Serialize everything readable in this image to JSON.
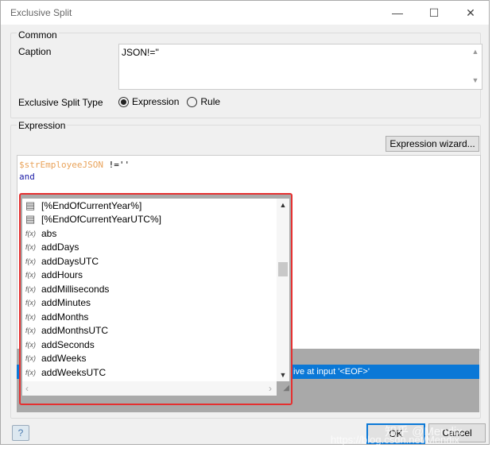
{
  "window": {
    "title": "Exclusive Split",
    "minimize": "—",
    "maximize": "☐",
    "close": "✕"
  },
  "common": {
    "group_label": "Common",
    "caption_label": "Caption",
    "caption_value": "JSON!=''",
    "split_type_label": "Exclusive Split Type",
    "options": [
      {
        "label": "Expression",
        "selected": true
      },
      {
        "label": "Rule",
        "selected": false
      }
    ]
  },
  "expression": {
    "group_label": "Expression",
    "wizard_button": "Expression wizard...",
    "code_line1_var": "$strEmployeeJSON",
    "code_line1_op": " !=''",
    "code_line2": "and"
  },
  "autocomplete": {
    "items": [
      {
        "icon": "constant-icon",
        "label": "[%EndOfCurrentYear%]"
      },
      {
        "icon": "constant-icon",
        "label": "[%EndOfCurrentYearUTC%]"
      },
      {
        "icon": "function-icon",
        "label": "abs"
      },
      {
        "icon": "function-icon",
        "label": "addDays"
      },
      {
        "icon": "function-icon",
        "label": "addDaysUTC"
      },
      {
        "icon": "function-icon",
        "label": "addHours"
      },
      {
        "icon": "function-icon",
        "label": "addMilliseconds"
      },
      {
        "icon": "function-icon",
        "label": "addMinutes"
      },
      {
        "icon": "function-icon",
        "label": "addMonths"
      },
      {
        "icon": "function-icon",
        "label": "addMonthsUTC"
      },
      {
        "icon": "function-icon",
        "label": "addSeconds"
      },
      {
        "icon": "function-icon",
        "label": "addWeeks"
      },
      {
        "icon": "function-icon",
        "label": "addWeeksUTC"
      }
    ],
    "highlight_color": "#e53030"
  },
  "error": {
    "text": "ive at input '<EOF>'"
  },
  "footer": {
    "help": "?",
    "ok": "OK",
    "cancel": "Cancel"
  },
  "watermark": {
    "line1": "知乎 @Mendix",
    "line2": "https://blog.csdn.net/Mendix"
  }
}
